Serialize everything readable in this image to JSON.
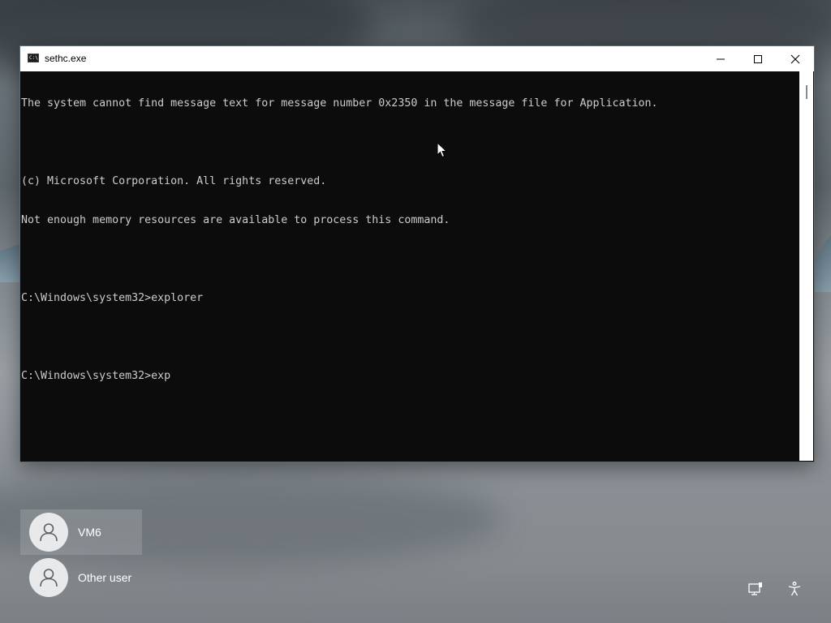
{
  "window": {
    "title": "sethc.exe",
    "icon": "cmd-console-icon",
    "controls": [
      "minimize-icon",
      "maximize-icon",
      "close-icon"
    ]
  },
  "console": {
    "lines": [
      "The system cannot find message text for message number 0x2350 in the message file for Application.",
      "",
      "(c) Microsoft Corporation. All rights reserved.",
      "Not enough memory resources are available to process this command.",
      "",
      "C:\\Windows\\system32>explorer",
      "",
      "C:\\Windows\\system32>exp"
    ]
  },
  "users": [
    {
      "name": "VM6",
      "icon": "user-avatar-icon",
      "selected": true
    },
    {
      "name": "Other user",
      "icon": "user-avatar-icon",
      "selected": false
    }
  ],
  "bottom_right_icons": [
    "network-icon",
    "accessibility-icon"
  ],
  "colors": {
    "console_bg": "#0c0c0c",
    "console_fg": "#cccccc",
    "titlebar_bg": "#ffffff"
  }
}
